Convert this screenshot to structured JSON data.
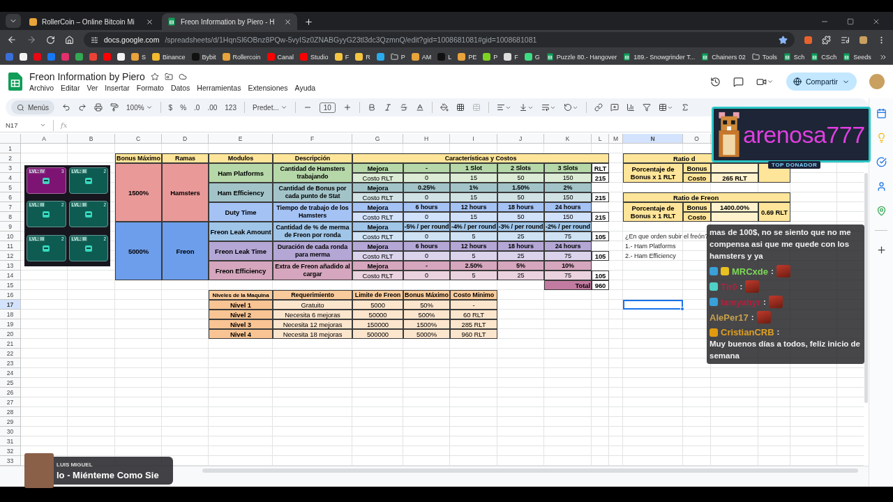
{
  "browser": {
    "tabs": [
      {
        "title": "RollerCoin – Online Bitcoin Mi",
        "selected": false,
        "kind": "site"
      },
      {
        "title": "Freon Information by Piero - H",
        "selected": true,
        "kind": "sheet"
      }
    ],
    "url": {
      "host": "docs.google.com",
      "path": "/spreadsheets/d/1HqnSl6OBnz8PQw-5vyISz0ZNABGyyG23tl3dc3QzmnQ/edit?gid=1008681081#gid=1008681081"
    },
    "bookmarks": [
      {
        "kind": "site",
        "color": "#3b6fd8"
      },
      {
        "kind": "site",
        "color": "#f2f2f2"
      },
      {
        "kind": "site",
        "color": "#e50914"
      },
      {
        "kind": "site",
        "color": "#1877f2"
      },
      {
        "kind": "site",
        "color": "#e1306c"
      },
      {
        "kind": "site",
        "color": "#34a853"
      },
      {
        "kind": "site",
        "color": "#ea4335"
      },
      {
        "kind": "site",
        "color": "#ff0000"
      },
      {
        "kind": "site",
        "color": "#f2f2f2"
      },
      {
        "kind": "site",
        "color": "#e8a33a",
        "label": "S"
      },
      {
        "kind": "site",
        "color": "#f3ba2f",
        "label": "Binance"
      },
      {
        "kind": "site",
        "color": "#111111",
        "label": "Bybit"
      },
      {
        "kind": "site",
        "color": "#e8a33a",
        "label": "Rollercoin"
      },
      {
        "kind": "site",
        "color": "#ff0000",
        "label": "Canal"
      },
      {
        "kind": "site",
        "color": "#ff0000",
        "label": "Studio"
      },
      {
        "kind": "site",
        "color": "#f5c542",
        "label": "F"
      },
      {
        "kind": "site",
        "color": "#f5c542",
        "label": "R"
      },
      {
        "kind": "site",
        "color": "#2aabee"
      },
      {
        "kind": "folder",
        "label": "P"
      },
      {
        "kind": "site",
        "color": "#e8a33a",
        "label": "AM"
      },
      {
        "kind": "site",
        "color": "#111111",
        "label": "L"
      },
      {
        "kind": "site",
        "color": "#e8a33a",
        "label": "PE"
      },
      {
        "kind": "site",
        "color": "#7ed321",
        "label": "P"
      },
      {
        "kind": "site",
        "color": "#dddddd",
        "label": "F"
      },
      {
        "kind": "site",
        "color": "#3ddc84",
        "label": "G"
      },
      {
        "kind": "sheet",
        "label": "Puzzle 80.- Hangover"
      },
      {
        "kind": "sheet",
        "label": "189.- Snowgrinder T..."
      },
      {
        "kind": "sheet",
        "label": "Chainers 02"
      },
      {
        "kind": "folder",
        "label": "Tools"
      },
      {
        "kind": "sheet",
        "label": "Sch"
      },
      {
        "kind": "sheet",
        "label": "CSch"
      },
      {
        "kind": "sheet",
        "label": "Seeds"
      }
    ]
  },
  "sheet": {
    "title": "Freon Information by Piero",
    "menus": [
      "Archivo",
      "Editar",
      "Ver",
      "Insertar",
      "Formato",
      "Datos",
      "Herramientas",
      "Extensiones",
      "Ayuda"
    ],
    "share": "Compartir",
    "toolbar": {
      "search": "Menús",
      "zoom": "100%",
      "currency": "$",
      "percent": "%",
      "decrease_decimals": ".0",
      "increase_decimals": ".00",
      "more_formats": "123",
      "font": "Predet...",
      "font_size": "10"
    },
    "name_box": "N17",
    "formula_label": "fx",
    "columns": [
      {
        "letter": "A",
        "selected": false
      },
      {
        "letter": "B",
        "selected": false
      },
      {
        "letter": "C",
        "selected": false
      },
      {
        "letter": "D",
        "selected": false
      },
      {
        "letter": "E",
        "selected": false
      },
      {
        "letter": "F",
        "selected": false
      },
      {
        "letter": "G",
        "selected": false
      },
      {
        "letter": "H",
        "selected": false
      },
      {
        "letter": "I",
        "selected": false
      },
      {
        "letter": "J",
        "selected": false
      },
      {
        "letter": "K",
        "selected": false
      },
      {
        "letter": "L",
        "selected": false
      },
      {
        "letter": "M",
        "selected": false
      },
      {
        "letter": "N",
        "selected": true
      },
      {
        "letter": "O",
        "selected": false
      }
    ],
    "rows": [
      {
        "label": "1",
        "selected": false
      },
      {
        "label": "2",
        "selected": false
      },
      {
        "label": "3",
        "selected": false
      },
      {
        "label": "4",
        "selected": false
      },
      {
        "label": "5",
        "selected": false
      },
      {
        "label": "6",
        "selected": false
      },
      {
        "label": "7",
        "selected": false
      },
      {
        "label": "8",
        "selected": false
      },
      {
        "label": "9",
        "selected": false
      },
      {
        "label": "10",
        "selected": false
      },
      {
        "label": "11",
        "selected": false
      },
      {
        "label": "12",
        "selected": false
      },
      {
        "label": "13",
        "selected": false
      },
      {
        "label": "14",
        "selected": false
      },
      {
        "label": "15",
        "selected": false
      },
      {
        "label": "16",
        "selected": false
      },
      {
        "label": "17",
        "selected": true
      },
      {
        "label": "18",
        "selected": false
      },
      {
        "label": "19",
        "selected": false
      },
      {
        "label": "20",
        "selected": false
      },
      {
        "label": "21",
        "selected": false
      },
      {
        "label": "22",
        "selected": false
      },
      {
        "label": "23",
        "selected": false
      },
      {
        "label": "24",
        "selected": false
      },
      {
        "label": "25",
        "selected": false
      },
      {
        "label": "26",
        "selected": false
      },
      {
        "label": "27",
        "selected": false
      },
      {
        "label": "28",
        "selected": false
      },
      {
        "label": "29",
        "selected": false
      },
      {
        "label": "30",
        "selected": false
      },
      {
        "label": "31",
        "selected": false
      },
      {
        "label": "32",
        "selected": false
      },
      {
        "label": "33",
        "selected": false
      }
    ],
    "game_panel": {
      "cards": [
        {
          "level": "LVL: IV",
          "count": "3",
          "color": "#7d1473"
        },
        {
          "level": "LVL: III",
          "count": "2",
          "color": "#0e5b52"
        },
        {
          "level": "LVL: III",
          "count": "2",
          "color": "#0e5b52"
        },
        {
          "level": "LVL: III",
          "count": "2",
          "color": "#0e5b52"
        },
        {
          "level": "LVL: III",
          "count": "2",
          "color": "#0e5b52"
        },
        {
          "level": "LVL: III",
          "count": "2",
          "color": "#0e5b52"
        }
      ]
    },
    "features_table": {
      "headers": [
        "Bonus Máximo",
        "Ramas",
        "Modulos",
        "Descripción",
        "Características y Costos"
      ],
      "branches": [
        {
          "bonus": "1500%",
          "name": "Hamsters",
          "color": "#ea9999",
          "modules": [
            {
              "name": "Ham Platforms",
              "description": "Cantidad de Hamsters trabajando",
              "color": "#b6d7a8",
              "upgrade_label": "Mejora",
              "upgrades": [
                "-",
                "1 Slot",
                "2 Slots",
                "3 Slots"
              ],
              "upgrade_unit": "RLT",
              "cost_label": "Costo RLT",
              "costs": [
                "0",
                "15",
                "50",
                "150"
              ],
              "sum": "215"
            },
            {
              "name": "Ham Efficiency",
              "description": "Cantidad de Bonus por cada punto de Stat",
              "color": "#a2c4c9",
              "upgrade_label": "Mejora",
              "upgrades": [
                "0.25%",
                "1%",
                "1.50%",
                "2%"
              ],
              "cost_label": "Costo RLT",
              "costs": [
                "0",
                "15",
                "50",
                "150"
              ],
              "sum": "215"
            },
            {
              "name": "Duty Time",
              "description": "Tiempo de trabajo de los Hamsters",
              "color": "#a4c2f4",
              "upgrade_label": "Mejora",
              "upgrades": [
                "6 hours",
                "12 hours",
                "18 hours",
                "24 hours"
              ],
              "cost_label": "Costo RLT",
              "costs": [
                "0",
                "15",
                "50",
                "150"
              ],
              "sum": "215"
            }
          ]
        },
        {
          "bonus": "5000%",
          "name": "Freon",
          "color": "#6d9eeb",
          "modules": [
            {
              "name": "Freon Leak Amount",
              "description": "Cantidad de % de merma de Freon por ronda",
              "color": "#9fc5e8",
              "upgrade_label": "Mejora",
              "upgrades": [
                "-5% / per round",
                "-4% / per round",
                "-3% / per round",
                "-2% / per round"
              ],
              "cost_label": "Costo RLT",
              "costs": [
                "0",
                "5",
                "25",
                "75"
              ],
              "sum": "105"
            },
            {
              "name": "Freon Leak Time",
              "description": "Duración de cada ronda para merma",
              "color": "#b4a7d6",
              "upgrade_label": "Mejora",
              "upgrades": [
                "6 hours",
                "12 hours",
                "18 hours",
                "24 hours"
              ],
              "cost_label": "Costo RLT",
              "costs": [
                "0",
                "5",
                "25",
                "75"
              ],
              "sum": "105"
            },
            {
              "name": "Freon Efficiency",
              "description": "Extra de Freon añadido al cargar",
              "color": "#d5a6bd",
              "upgrade_label": "Mejora",
              "upgrades": [
                "-",
                "2.50%",
                "5%",
                "10%"
              ],
              "cost_label": "Costo RLT",
              "costs": [
                "0",
                "5",
                "25",
                "75"
              ],
              "sum": "105"
            }
          ]
        }
      ],
      "total_label": "Total",
      "total": "960"
    },
    "levels_table": {
      "headers": [
        "Niveles de la Maquina",
        "Requerimiento",
        "Limite de Freon",
        "Bonus Máximo",
        "Costo Minimo"
      ],
      "rows": [
        [
          "Nivel 1",
          "Gratuito",
          "5000",
          "50%",
          "-"
        ],
        [
          "Nivel 2",
          "Necesita 6 mejoras",
          "50000",
          "500%",
          "60 RLT"
        ],
        [
          "Nivel 3",
          "Necesita 12 mejoras",
          "150000",
          "1500%",
          "285 RLT"
        ],
        [
          "Nivel 4",
          "Necesita 18 mejoras",
          "500000",
          "5000%",
          "960 RLT"
        ]
      ]
    },
    "ratio_tables": [
      {
        "title": "Ratio d",
        "label": "Porcentaje de Bonus x 1 RLT",
        "bonus_label": "Bonus",
        "cost_label": "Costo",
        "cost": "265 RLT"
      },
      {
        "title": "Ratio de Freon",
        "label": "Porcentaje de Bonus x 1 RLT",
        "bonus_label": "Bonus",
        "bonus": "1400.00%",
        "cost_label": "Costo",
        "ratio": "0.69 RLT"
      }
    ],
    "notes": [
      "¿En que orden subir el freón?",
      "1.- Ham Platforms",
      "2.- Ham Efficiency"
    ]
  },
  "donor_alert": {
    "name": "arenosa777",
    "badge": "TOP DONADOR"
  },
  "chat": [
    {
      "text": "mas de 100$, no se siento que no me compensa asi que me quede con los hamsters y ya"
    },
    {
      "user": "MRCxde",
      "color": "#7ed957",
      "sep": ":",
      "badges": [
        {
          "kind": "mod"
        },
        {
          "kind": "sub"
        }
      ],
      "emote": true
    },
    {
      "user": "Tir0",
      "color": "#b3203c",
      "sep": ":",
      "badges": [
        {
          "kind": "vip"
        }
      ],
      "emote": true
    },
    {
      "user": "Iamyahyr",
      "color": "#b3203c",
      "sep": ":",
      "badges": [
        {
          "kind": "mod"
        }
      ],
      "emote": true
    },
    {
      "user": "AlePer17",
      "color": "#c9a14a",
      "sep": ":",
      "emote": true
    },
    {
      "user": "CristianCRB",
      "color": "#e0a020",
      "sep": ":",
      "badges": [
        {
          "kind": "coin"
        }
      ],
      "text": "Muy buenos días a todos, feliz inicio de semana"
    }
  ],
  "music": {
    "artist": "LUIS MIGUEL",
    "song": "lo - Miénteme Como Sie"
  }
}
